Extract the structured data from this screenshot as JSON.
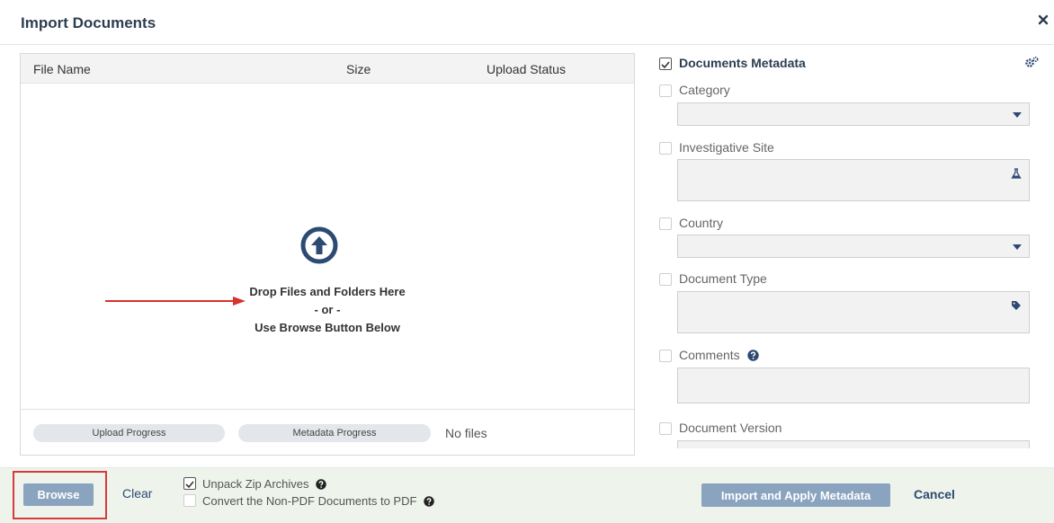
{
  "dialog": {
    "title": "Import Documents"
  },
  "file_list": {
    "columns": [
      "File Name",
      "Size",
      "Upload Status"
    ],
    "drop_text_1": "Drop Files and Folders Here",
    "drop_text_2": "- or -",
    "drop_text_3": "Use Browse Button Below",
    "upload_progress_label": "Upload Progress",
    "metadata_progress_label": "Metadata Progress",
    "status": "No files"
  },
  "metadata": {
    "header_label": "Documents Metadata",
    "fields": [
      {
        "label": "Category",
        "type": "select"
      },
      {
        "label": "Investigative Site",
        "type": "lookup",
        "icon": "flask-icon"
      },
      {
        "label": "Country",
        "type": "select"
      },
      {
        "label": "Document Type",
        "type": "lookup",
        "icon": "tag-icon"
      },
      {
        "label": "Comments",
        "type": "text",
        "icon": "help-icon"
      },
      {
        "label": "Document Version",
        "type": "text"
      }
    ]
  },
  "footer": {
    "browse_label": "Browse",
    "clear_label": "Clear",
    "unpack_label": "Unpack Zip Archives",
    "convert_label": "Convert the Non-PDF Documents to PDF",
    "import_label": "Import and Apply Metadata",
    "cancel_label": "Cancel"
  },
  "colors": {
    "accent": "#2d4a73",
    "button": "#8aa3bf",
    "footer_bg": "#eef4ec",
    "highlight": "#d83a3a"
  }
}
